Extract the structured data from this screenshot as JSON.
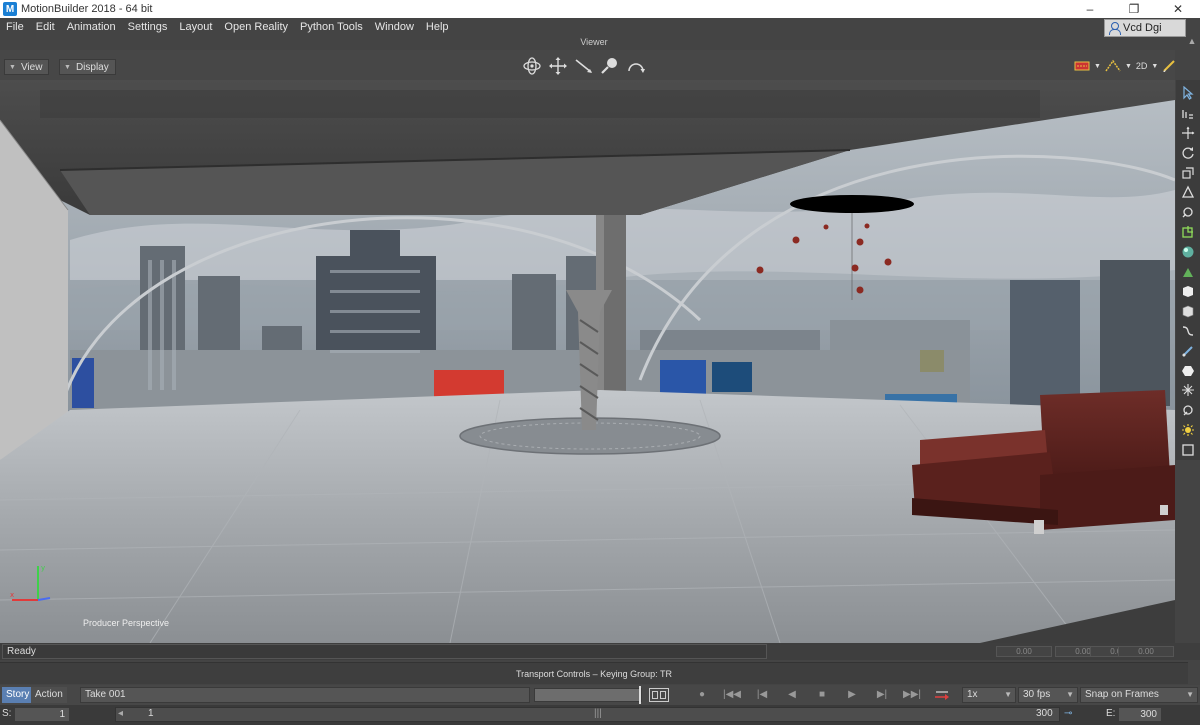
{
  "app": {
    "title": "MotionBuilder 2018 - 64 bit",
    "logo_letter": "M"
  },
  "window_controls": [
    "–",
    "❐",
    "✕"
  ],
  "menu": [
    "File",
    "Edit",
    "Animation",
    "Settings",
    "Layout",
    "Open Reality",
    "Python Tools",
    "Window",
    "Help"
  ],
  "user": {
    "name": "Vcd Dgi"
  },
  "viewer": {
    "title": "Viewer",
    "view_label": "View",
    "display_label": "Display",
    "mode_2d": "2D",
    "camera_label": "Producer Perspective"
  },
  "status": {
    "text": "Ready",
    "coords": [
      "0.00",
      "0.00",
      "0.00",
      "0.00"
    ]
  },
  "transport": {
    "title": "Transport Controls  –  Keying Group: TR",
    "story_tab": "Story",
    "action_tab": "Action",
    "take": "Take 001",
    "speed": "1x",
    "fps": "30 fps",
    "snap": "Snap on Frames"
  },
  "timeline": {
    "start_label": "S:",
    "start_value": "1",
    "current_frame": "1",
    "end_marker": "300",
    "end_label": "E:",
    "end_value": "300"
  },
  "colors": {
    "accent": "#5a7fb2",
    "sofa": "#5c2320",
    "sky": "#a9b2ba",
    "floor": "#9ea2a6"
  }
}
